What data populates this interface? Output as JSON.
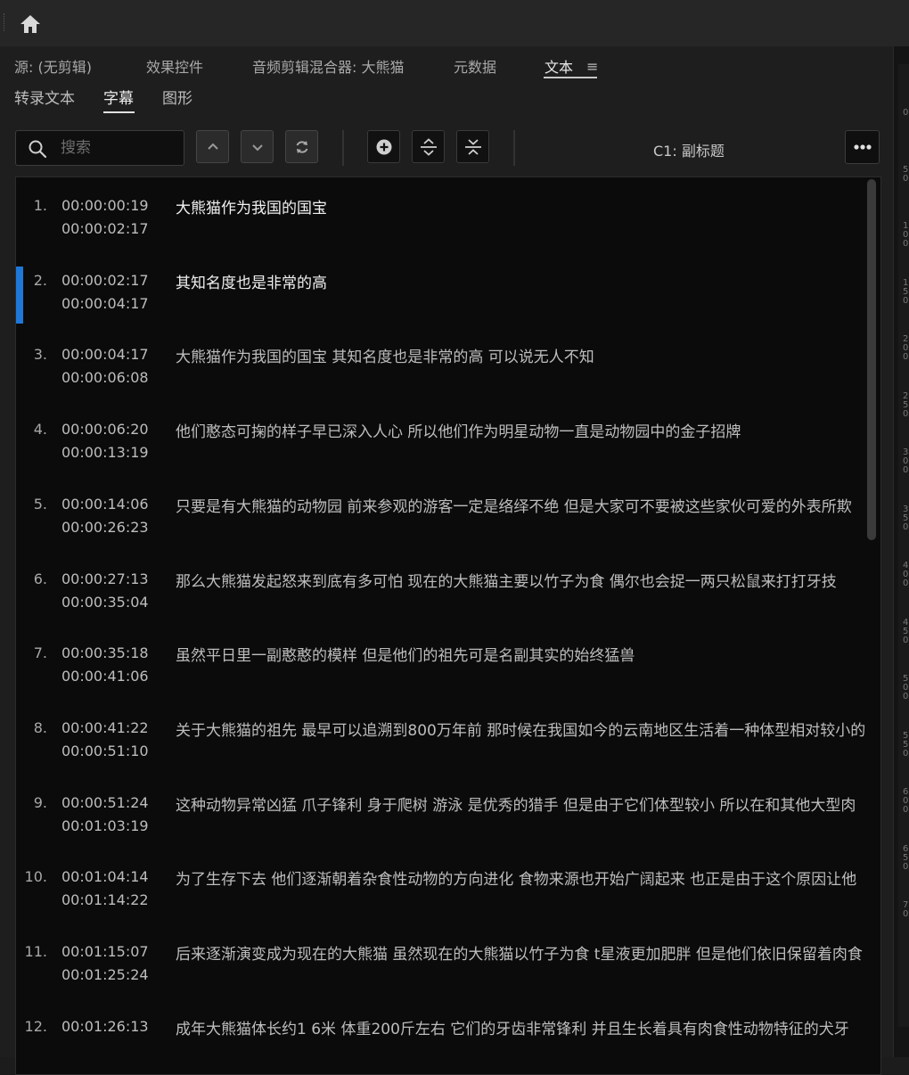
{
  "panel_tabs": [
    {
      "label": "源: (无剪辑)",
      "active": false
    },
    {
      "label": "效果控件",
      "active": false
    },
    {
      "label": "音频剪辑混合器: 大熊猫",
      "active": false
    },
    {
      "label": "元数据",
      "active": false
    },
    {
      "label": "文本",
      "active": true
    }
  ],
  "panel_menu_icon": "≡",
  "sub_tabs": [
    {
      "label": "转录文本",
      "active": false
    },
    {
      "label": "字幕",
      "active": true
    },
    {
      "label": "图形",
      "active": false
    }
  ],
  "search": {
    "placeholder": "搜索"
  },
  "track_label": "C1: 副标题",
  "icons": {
    "home": "home-icon",
    "search": "search-icon",
    "prev": "chevron-up-icon",
    "next": "chevron-down-icon",
    "replace": "refresh-icon",
    "add": "plus-circle-icon",
    "split": "split-icon",
    "merge": "merge-icon",
    "more": "more-icon"
  },
  "accent_color": "#1e78d8",
  "captions": [
    {
      "num": "1.",
      "start": "00:00:00:19",
      "end": "00:00:02:17",
      "text": "大熊猫作为我国的国宝",
      "highlight": true,
      "selected": false
    },
    {
      "num": "2.",
      "start": "00:00:02:17",
      "end": "00:00:04:17",
      "text": "其知名度也是非常的高",
      "highlight": true,
      "selected": true
    },
    {
      "num": "3.",
      "start": "00:00:04:17",
      "end": "00:00:06:08",
      "text": "大熊猫作为我国的国宝 其知名度也是非常的高 可以说无人不知",
      "highlight": false,
      "selected": false
    },
    {
      "num": "4.",
      "start": "00:00:06:20",
      "end": "00:00:13:19",
      "text": "他们憨态可掬的样子早已深入人心 所以他们作为明星动物一直是动物园中的金子招牌",
      "highlight": false,
      "selected": false
    },
    {
      "num": "5.",
      "start": "00:00:14:06",
      "end": "00:00:26:23",
      "text": "只要是有大熊猫的动物园 前来参观的游客一定是络绎不绝 但是大家可不要被这些家伙可爱的外表所欺",
      "highlight": false,
      "selected": false
    },
    {
      "num": "6.",
      "start": "00:00:27:13",
      "end": "00:00:35:04",
      "text": "那么大熊猫发起怒来到底有多可怕 现在的大熊猫主要以竹子为食 偶尔也会捉一两只松鼠来打打牙技",
      "highlight": false,
      "selected": false
    },
    {
      "num": "7.",
      "start": "00:00:35:18",
      "end": "00:00:41:06",
      "text": "虽然平日里一副憨憨的模样 但是他们的祖先可是名副其实的始终猛兽",
      "highlight": false,
      "selected": false
    },
    {
      "num": "8.",
      "start": "00:00:41:22",
      "end": "00:00:51:10",
      "text": "关于大熊猫的祖先 最早可以追溯到800万年前 那时候在我国如今的云南地区生活着一种体型相对较小的",
      "highlight": false,
      "selected": false
    },
    {
      "num": "9.",
      "start": "00:00:51:24",
      "end": "00:01:03:19",
      "text": "这种动物异常凶猛 爪子锋利 身于爬树 游泳 是优秀的猎手 但是由于它们体型较小 所以在和其他大型肉",
      "highlight": false,
      "selected": false
    },
    {
      "num": "10.",
      "start": "00:01:04:14",
      "end": "00:01:14:22",
      "text": "为了生存下去 他们逐渐朝着杂食性动物的方向进化 食物来源也开始广阔起来 也正是由于这个原因让他",
      "highlight": false,
      "selected": false
    },
    {
      "num": "11.",
      "start": "00:01:15:07",
      "end": "00:01:25:24",
      "text": "后来逐渐演变成为现在的大熊猫 虽然现在的大熊猫以竹子为食 t星液更加肥胖 但是他们依旧保留着肉食",
      "highlight": false,
      "selected": false
    },
    {
      "num": "12.",
      "start": "00:01:26:13",
      "end": "",
      "text": "成年大熊猫体长约1 6米 体重200斤左右 它们的牙齿非常锋利 并且生长着具有肉食性动物特征的犬牙",
      "highlight": false,
      "selected": false
    }
  ],
  "ruler_labels": [
    "0",
    "50",
    "100",
    "150",
    "200",
    "250",
    "300",
    "350",
    "400",
    "450",
    "500",
    "550",
    "600",
    "650",
    "70"
  ]
}
